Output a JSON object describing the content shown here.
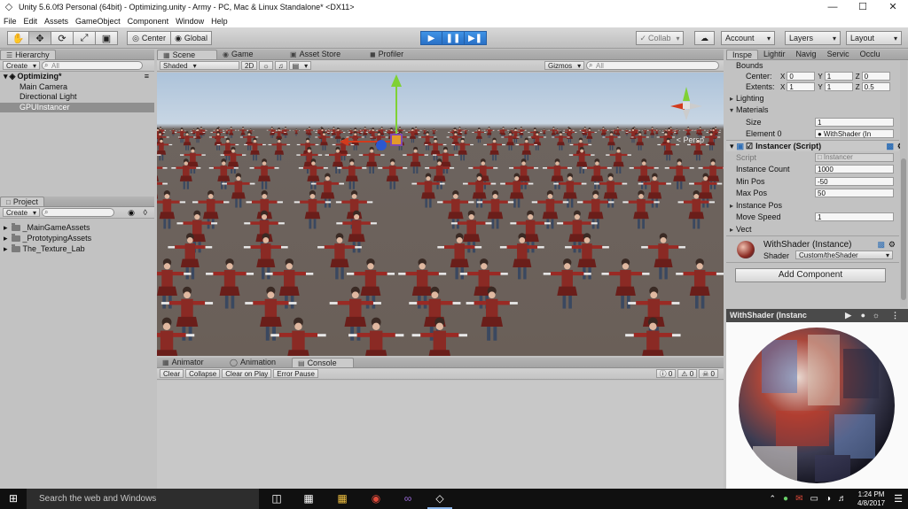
{
  "window": {
    "title": "Unity 5.6.0f3 Personal (64bit) - Optimizing.unity - Army - PC, Mac & Linux Standalone* <DX11>",
    "minimize": "—",
    "maximize": "☐",
    "close": "✕"
  },
  "menu": [
    "File",
    "Edit",
    "Assets",
    "GameObject",
    "Component",
    "Window",
    "Help"
  ],
  "toolbar": {
    "tools": [
      "✋",
      "✥",
      "⟳",
      "⤢",
      "▣"
    ],
    "center_label": "Center",
    "global_label": "Global",
    "collab_label": "Collab",
    "account_label": "Account",
    "layers_label": "Layers",
    "layout_label": "Layout"
  },
  "hierarchy": {
    "tab": "Hierarchy",
    "create": "Create",
    "search_placeholder": "All",
    "scene_name": "Optimizing*",
    "objects": [
      "Main Camera",
      "Directional Light",
      "GPUInstancer"
    ]
  },
  "project": {
    "tab": "Project",
    "create": "Create",
    "folders": [
      "_MainGameAssets",
      "_PrototypingAssets",
      "The_Texture_Lab"
    ]
  },
  "scene_tabs": {
    "scene": "Scene",
    "game": "Game",
    "asset_store": "Asset Store",
    "profiler": "Profiler"
  },
  "scene_bar": {
    "shading": "Shaded",
    "mode_2d": "2D",
    "gizmos": "Gizmos",
    "search_placeholder": "All",
    "persp": "< Persp"
  },
  "console": {
    "tabs": [
      "Animator",
      "Animation",
      "Console"
    ],
    "buttons": [
      "Clear",
      "Collapse",
      "Clear on Play",
      "Error Pause"
    ],
    "counts": [
      "0",
      "0",
      "0"
    ]
  },
  "inspector": {
    "tabs": [
      "Inspe",
      "Lightir",
      "Navig",
      "Servic",
      "Occlu"
    ],
    "bounds_label": "Bounds",
    "center_label": "Center:",
    "extents_label": "Extents:",
    "center": {
      "x": "0",
      "y": "1",
      "z": "0"
    },
    "extents": {
      "x": "1",
      "y": "1",
      "z": "0.5"
    },
    "axes": [
      "X",
      "Y",
      "Z"
    ],
    "lighting_label": "Lighting",
    "materials_label": "Materials",
    "size_label": "Size",
    "size_value": "1",
    "element0_label": "Element 0",
    "element0_value": "WithShader (In",
    "component_title": "Instancer (Script)",
    "script_label": "Script",
    "script_value": "Instancer",
    "fields": [
      {
        "label": "Instance Count",
        "value": "1000"
      },
      {
        "label": "Min Pos",
        "value": "-50"
      },
      {
        "label": "Max Pos",
        "value": "50"
      }
    ],
    "instance_pos_label": "Instance Pos",
    "move_speed_label": "Move Speed",
    "move_speed_value": "1",
    "vect_label": "Vect",
    "material_name": "WithShader (Instance)",
    "shader_label": "Shader",
    "shader_value": "Custom/theShader",
    "add_component": "Add Component"
  },
  "preview": {
    "title": "WithShader (Instanc"
  },
  "taskbar": {
    "search_placeholder": "Search the web and Windows",
    "time": "1:24 PM",
    "date": "4/8/2017"
  },
  "colors": {
    "accent": "#2f7fd8",
    "panel": "#c2c2c2",
    "selection": "#8f8f8f",
    "taskbar": "#101010"
  }
}
